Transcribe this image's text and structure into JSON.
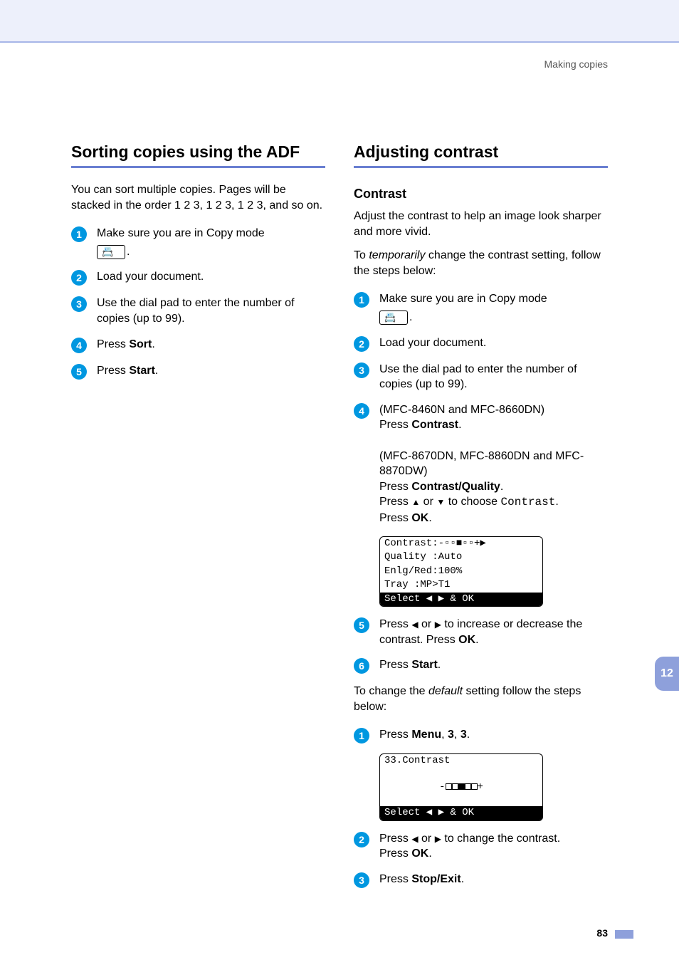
{
  "header": {
    "breadcrumb": "Making copies"
  },
  "left": {
    "title": "Sorting copies using the ADF",
    "intro": "You can sort multiple copies. Pages will be stacked in the order 1 2 3, 1 2 3, 1 2 3, and so on.",
    "steps": {
      "s1": "Make sure you are in Copy mode ",
      "s1_suffix": ".",
      "s2": "Load your document.",
      "s3": "Use the dial pad to enter the number of copies (up to 99).",
      "s4_a": "Press ",
      "s4_b": "Sort",
      "s4_c": ".",
      "s5_a": "Press ",
      "s5_b": "Start",
      "s5_c": "."
    }
  },
  "right": {
    "title": "Adjusting contrast",
    "subsection": "Contrast",
    "intro1": "Adjust the contrast to help an image look sharper and more vivid.",
    "intro2_a": "To ",
    "intro2_b": "temporarily",
    "intro2_c": " change the contrast setting, follow the steps below:",
    "steps": {
      "s1": "Make sure you are in Copy mode ",
      "s1_suffix": ".",
      "s2": "Load your document.",
      "s3": "Use the dial pad to enter the number of copies (up to 99).",
      "s4_a": "(MFC-8460N and MFC-8660DN)",
      "s4_b": "Press ",
      "s4_c": "Contrast",
      "s4_d": ".",
      "s4_e": "(MFC-8670DN, MFC-8860DN and MFC-8870DW)",
      "s4_f": "Press ",
      "s4_g": "Contrast/Quality",
      "s4_h": ".",
      "s4_i": "Press ",
      "s4_j": " or ",
      "s4_k": " to choose ",
      "s4_l": "Contrast",
      "s4_m": ".",
      "s4_n": "Press ",
      "s4_o": "OK",
      "s4_p": ".",
      "s5_a": "Press ",
      "s5_b": " or ",
      "s5_c": " to increase or decrease the contrast. Press ",
      "s5_d": "OK",
      "s5_e": ".",
      "s6_a": "Press ",
      "s6_b": "Start",
      "s6_c": "."
    },
    "lcd1": {
      "r1": "Contrast:-▫▫■▫▫+▶",
      "r2": "Quality :Auto",
      "r3": "Enlg/Red:100%",
      "r4": "Tray    :MP>T1",
      "r5": "Select ◀ ▶ & OK"
    },
    "intro3_a": "To change the ",
    "intro3_b": "default",
    "intro3_c": " setting follow the steps below:",
    "steps2": {
      "s1_a": "Press ",
      "s1_b": "Menu",
      "s1_c": ", ",
      "s1_d": "3",
      "s1_e": ", ",
      "s1_f": "3",
      "s1_g": ".",
      "s2_a": "Press ",
      "s2_b": " or ",
      "s2_c": " to change the contrast.",
      "s2_d": "Press ",
      "s2_e": "OK",
      "s2_f": ".",
      "s3_a": "Press ",
      "s3_b": "Stop/Exit",
      "s3_c": "."
    },
    "lcd2": {
      "r1": "33.Contrast",
      "r2_pre": "-",
      "r2_post": "+",
      "r3": "Select ◀ ▶ & OK"
    }
  },
  "sidetab": "12",
  "pagenum": "83",
  "icons": {
    "up": "▲",
    "down": "▼",
    "left": "◀",
    "right": "▶"
  },
  "nums": {
    "n1": "1",
    "n2": "2",
    "n3": "3",
    "n4": "4",
    "n5": "5",
    "n6": "6"
  }
}
